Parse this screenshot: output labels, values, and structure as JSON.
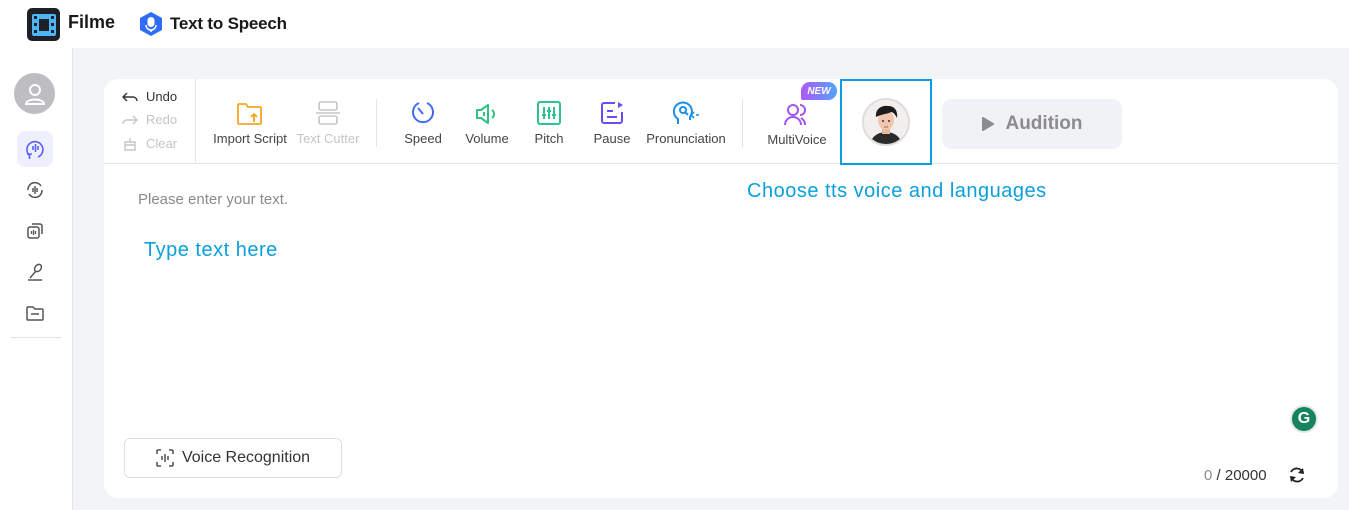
{
  "app": {
    "name": "Filme",
    "section": "Text to Speech",
    "logo_icon": "film-strip-icon",
    "section_icon": "microphone-hexagon-icon"
  },
  "sidebar": {
    "avatar_icon": "user-icon",
    "items": [
      {
        "name": "text-to-speech",
        "icon": "speech-wave-icon",
        "active": true
      },
      {
        "name": "voice-changer",
        "icon": "audio-cycle-icon",
        "active": false
      },
      {
        "name": "voice-library",
        "icon": "audio-stack-icon",
        "active": false
      },
      {
        "name": "recording",
        "icon": "microphone-stand-icon",
        "active": false
      },
      {
        "name": "files",
        "icon": "folder-icon",
        "active": false
      }
    ]
  },
  "toolbar": {
    "history": [
      {
        "label": "Undo",
        "icon": "undo-arrow-icon",
        "enabled": true
      },
      {
        "label": "Redo",
        "icon": "redo-arrow-icon",
        "enabled": false
      },
      {
        "label": "Clear",
        "icon": "broom-icon",
        "enabled": false
      }
    ],
    "tools": [
      {
        "label": "Import Script",
        "icon": "folder-upload-icon",
        "enabled": true,
        "color": "#f5a623"
      },
      {
        "label": "Text Cutter",
        "icon": "split-icon",
        "enabled": false,
        "color": "#c5c5c8"
      },
      {
        "label": "Speed",
        "icon": "speedometer-icon",
        "enabled": true,
        "color": "#3d6bf5"
      },
      {
        "label": "Volume",
        "icon": "speaker-icon",
        "enabled": true,
        "color": "#2ec27e"
      },
      {
        "label": "Pitch",
        "icon": "equalizer-icon",
        "enabled": true,
        "color": "#2ec28f"
      },
      {
        "label": "Pause",
        "icon": "pause-text-icon",
        "enabled": true,
        "color": "#6a4cf5"
      },
      {
        "label": "Pronunciation",
        "icon": "head-speak-icon",
        "enabled": true,
        "color": "#1d8fe8"
      },
      {
        "label": "MultiVoice",
        "icon": "users-icon",
        "enabled": true,
        "color": "#a056f0"
      }
    ],
    "multivoice_badge": "NEW",
    "voice_avatar_icon": "voice-character-avatar",
    "audition_label": "Audition",
    "audition_icon": "play-icon"
  },
  "editor": {
    "placeholder": "Please enter your text.",
    "annotation_type": "Type text here",
    "annotation_voice": "Choose tts voice and languages",
    "voice_recognition_label": "Voice Recognition",
    "char_count": "0",
    "char_separator": " / ",
    "char_limit": "20000"
  },
  "colors": {
    "annotation": "#0ba0dc",
    "highlight_border": "#0a9ee0",
    "active_sidebar_bg": "#eef0ff",
    "grammarly": "#15845d"
  }
}
